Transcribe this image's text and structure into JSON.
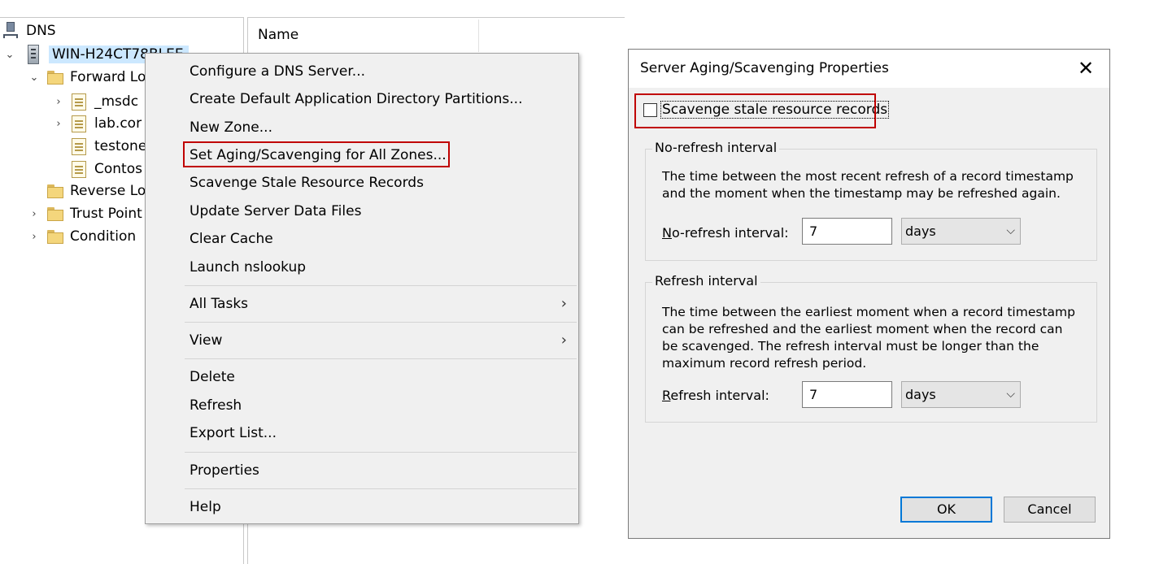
{
  "tree": {
    "root": "DNS",
    "server": "WIN-H24CT78BLEE",
    "forward": "Forward Lo",
    "zones": [
      "_msdc",
      "lab.cor",
      "testone",
      "Contos"
    ],
    "reverse": "Reverse Lo",
    "trust": "Trust Point",
    "conditional": "Condition"
  },
  "list": {
    "header_name": "Name"
  },
  "context_menu": {
    "items": [
      "Configure a DNS Server...",
      "Create Default Application Directory Partitions...",
      "New Zone...",
      "Set Aging/Scavenging for All Zones...",
      "Scavenge Stale Resource Records",
      "Update Server Data Files",
      "Clear Cache",
      "Launch nslookup",
      "All Tasks",
      "View",
      "Delete",
      "Refresh",
      "Export List...",
      "Properties",
      "Help"
    ],
    "submenu_glyph": "›"
  },
  "dialog": {
    "title": "Server Aging/Scavenging Properties",
    "close_glyph": "✕",
    "scavenge_checkbox_label": "Scavenge stale resource records",
    "scavenge_checked": false,
    "no_refresh": {
      "group_title": "No-refresh interval",
      "description": "The time between the most recent refresh of a record timestamp and the moment when the timestamp may be refreshed again.",
      "field_label": "No-refresh interval:",
      "value": "7",
      "unit": "days"
    },
    "refresh": {
      "group_title": "Refresh interval",
      "description": "The time between the earliest moment when a record timestamp can be refreshed and the earliest moment when the record can be scavenged. The refresh interval must be longer than the maximum record refresh period.",
      "field_label": "Refresh interval:",
      "value": "7",
      "unit": "days"
    },
    "ok_label": "OK",
    "cancel_label": "Cancel"
  },
  "colors": {
    "highlight_box": "#c00000",
    "default_button_border": "#0078d7",
    "selection": "#cce8ff"
  }
}
